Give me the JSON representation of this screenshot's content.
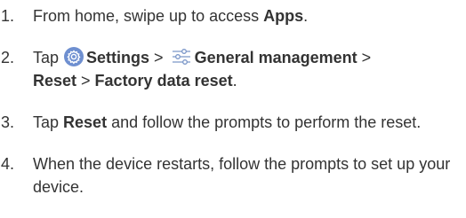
{
  "steps": [
    {
      "number": "1.",
      "parts": {
        "a": "From home, swipe up to access ",
        "b": "Apps",
        "c": "."
      }
    },
    {
      "number": "2.",
      "parts": {
        "a": "Tap ",
        "b": "Settings",
        "c": " > ",
        "d": "General management",
        "e": " > ",
        "f": "Reset",
        "g": " > ",
        "h": "Factory data reset",
        "i": "."
      },
      "icons": [
        "gear-icon",
        "sliders-icon"
      ]
    },
    {
      "number": "3.",
      "parts": {
        "a": "Tap ",
        "b": "Reset",
        "c": " and follow the prompts to perform the reset."
      }
    },
    {
      "number": "4.",
      "parts": {
        "a": "When the device restarts, follow the prompts to set up your device."
      }
    }
  ],
  "colors": {
    "text": "#333333",
    "settings_icon_bg": "#6e8fd0",
    "sliders_icon": "#7a96c8"
  }
}
